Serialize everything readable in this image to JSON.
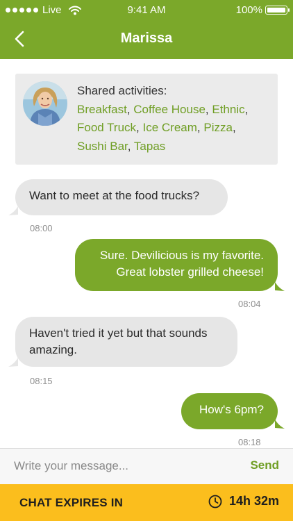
{
  "status_bar": {
    "carrier": "Live",
    "time": "9:41 AM",
    "battery": "100%"
  },
  "nav": {
    "title": "Marissa"
  },
  "activities": {
    "label": "Shared activities:",
    "items": [
      "Breakfast",
      "Coffee House",
      "Ethnic",
      "Food Truck",
      "Ice Cream",
      "Pizza",
      "Sushi Bar",
      "Tapas"
    ]
  },
  "messages": [
    {
      "direction": "incoming",
      "lines": [
        "Want to meet at the food trucks?"
      ],
      "time": "08:00"
    },
    {
      "direction": "outgoing",
      "lines": [
        "Sure. Devilicious is my favorite.",
        "Great lobster grilled cheese!"
      ],
      "time": "08:04"
    },
    {
      "direction": "incoming",
      "lines": [
        "Haven't tried it yet but that sounds",
        "amazing."
      ],
      "time": "08:15"
    },
    {
      "direction": "outgoing",
      "lines": [
        "How's 6pm?"
      ],
      "time": "08:18"
    }
  ],
  "composer": {
    "placeholder": "Write your message...",
    "send_label": "Send"
  },
  "footer": {
    "label": "CHAT EXPIRES IN",
    "countdown": "14h 32m"
  },
  "colors": {
    "brand": "#7ba82a",
    "tag": "#6f9e24",
    "footer": "#fbbe1d",
    "bubble_in": "#e6e6e6"
  },
  "icons": [
    "signal-dots-icon",
    "wifi-icon",
    "battery-icon",
    "back-chevron-icon",
    "clock-icon"
  ]
}
